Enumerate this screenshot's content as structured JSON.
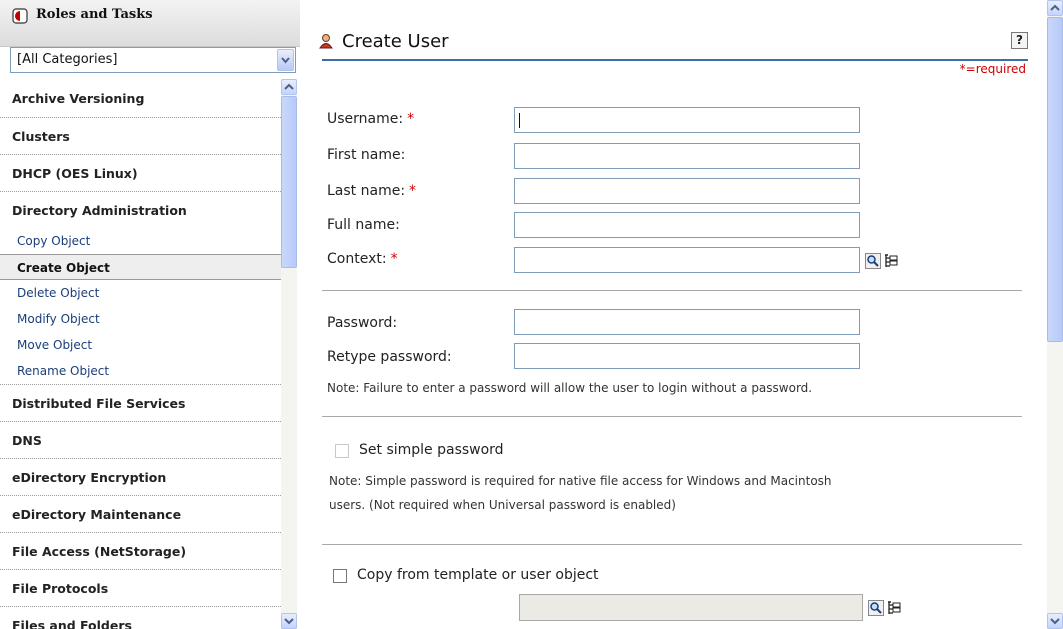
{
  "sidebar": {
    "header_title": "Roles and Tasks",
    "category_select": {
      "value": "[All Categories]"
    },
    "items": [
      {
        "type": "category",
        "label": "Archive Versioning"
      },
      {
        "type": "category",
        "label": "Clusters"
      },
      {
        "type": "category",
        "label": "DHCP (OES Linux)"
      },
      {
        "type": "category",
        "label": "Directory Administration"
      },
      {
        "type": "task",
        "label": "Copy Object"
      },
      {
        "type": "task",
        "label": "Create Object",
        "selected": true
      },
      {
        "type": "task",
        "label": "Delete Object"
      },
      {
        "type": "task",
        "label": "Modify Object"
      },
      {
        "type": "task",
        "label": "Move Object"
      },
      {
        "type": "task",
        "label": "Rename Object"
      },
      {
        "type": "category",
        "label": "Distributed File Services"
      },
      {
        "type": "category",
        "label": "DNS"
      },
      {
        "type": "category",
        "label": "eDirectory Encryption"
      },
      {
        "type": "category",
        "label": "eDirectory Maintenance"
      },
      {
        "type": "category",
        "label": "File Access (NetStorage)"
      },
      {
        "type": "category",
        "label": "File Protocols"
      },
      {
        "type": "category",
        "label": "Files and Folders"
      }
    ]
  },
  "main": {
    "title": "Create User",
    "help_label": "?",
    "required_note": "*=required",
    "required_marker": "*",
    "fields": {
      "username": {
        "label": "Username:",
        "required": true,
        "value": ""
      },
      "first_name": {
        "label": "First name:",
        "value": ""
      },
      "last_name": {
        "label": "Last name:",
        "required": true,
        "value": ""
      },
      "full_name": {
        "label": "Full name:",
        "value": ""
      },
      "context": {
        "label": "Context:",
        "required": true,
        "value": ""
      },
      "password": {
        "label": "Password:",
        "value": ""
      },
      "retype_password": {
        "label": "Retype password:",
        "value": ""
      }
    },
    "password_note": "Note: Failure to enter a password will allow the user to login without a password.",
    "simple_password": {
      "label": "Set simple password",
      "checked": false,
      "enabled": false,
      "note_line1": "Note: Simple password is required for native file access for Windows and Macintosh",
      "note_line2": "users. (Not required when Universal password is enabled)"
    },
    "copy_template": {
      "label": "Copy from template or user object",
      "checked": false,
      "value": ""
    }
  },
  "colors": {
    "accent_rule": "#3a6ea5",
    "required_red": "#cc0000",
    "field_border": "#7f9db9"
  },
  "icons": [
    "roles-tasks-icon",
    "user-icon",
    "help-icon",
    "search-icon",
    "object-browser-icon"
  ]
}
